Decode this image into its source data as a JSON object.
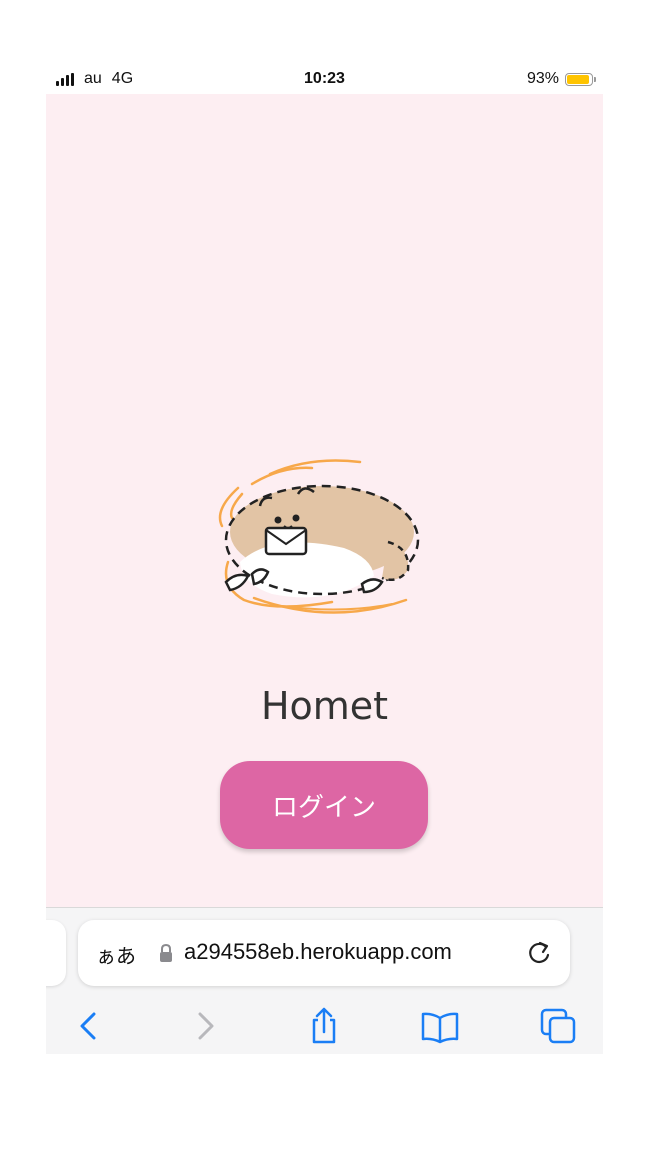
{
  "status_bar": {
    "carrier": "au",
    "network": "4G",
    "time": "10:23",
    "battery": "93%",
    "battery_level": 0.93,
    "battery_color": "#ffc400"
  },
  "page": {
    "background": "#fdeef2",
    "app_title": "Homet",
    "login_label": "ログイン",
    "accent": "#dd66a4"
  },
  "browser": {
    "reader_label": "ぁあ",
    "url": "a294558eb.herokuapp.com",
    "icons": [
      "lock-icon",
      "reload-icon",
      "back-icon",
      "forward-icon",
      "share-icon",
      "bookmarks-icon",
      "tabs-icon"
    ],
    "tint": "#1a7ef5"
  }
}
